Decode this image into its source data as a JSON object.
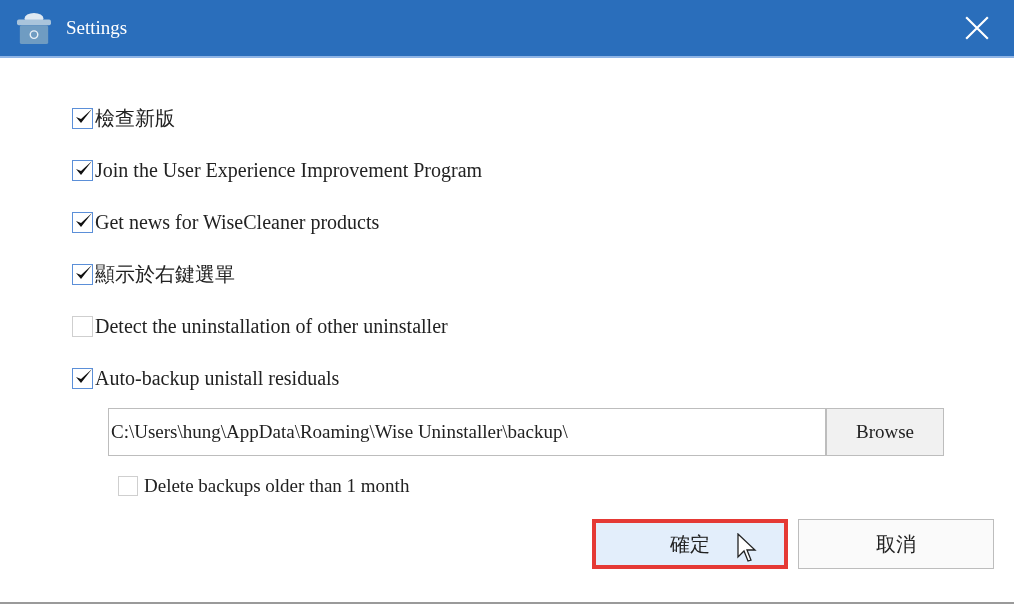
{
  "window": {
    "title": "Settings"
  },
  "options": [
    {
      "label": "檢查新版",
      "checked": true
    },
    {
      "label": "Join the User Experience Improvement Program",
      "checked": true
    },
    {
      "label": "Get news for WiseCleaner products",
      "checked": true
    },
    {
      "label": "顯示於右鍵選單",
      "checked": true
    },
    {
      "label": "Detect the uninstallation of other uninstaller",
      "checked": false
    },
    {
      "label": "Auto-backup unistall residuals",
      "checked": true
    }
  ],
  "backup": {
    "path": "C:\\Users\\hung\\AppData\\Roaming\\Wise Uninstaller\\backup\\",
    "browse": "Browse",
    "delete_old": {
      "label": "Delete backups older than 1 month",
      "checked": false
    }
  },
  "buttons": [
    {
      "label": "確定",
      "highlighted": true
    },
    {
      "label": "取消",
      "highlighted": false
    }
  ]
}
